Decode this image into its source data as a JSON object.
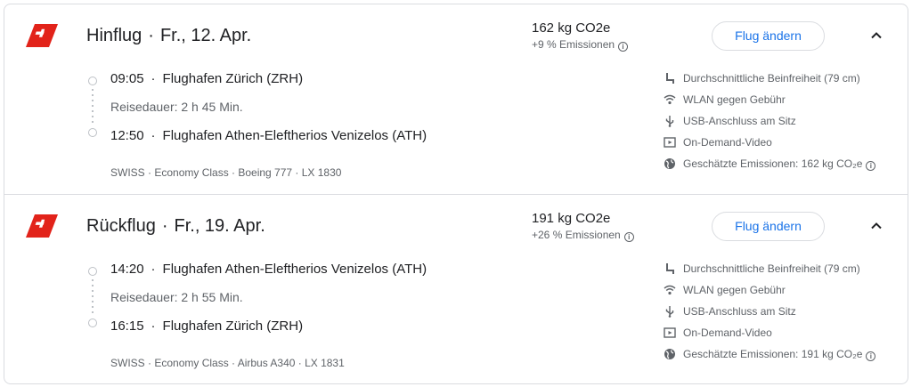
{
  "colors": {
    "accent": "#1a73e8",
    "swiss_red": "#e2231a",
    "muted": "#5f6368",
    "border": "#dadce0"
  },
  "segments": [
    {
      "title": "Hinflug",
      "title_sep": "·",
      "date": "Fr., 12. Apr.",
      "co2": "162 kg CO2e",
      "emissions": "+9 % Emissionen",
      "change_button": "Flug ändern",
      "departure": {
        "time": "09:05",
        "sep": "·",
        "airport": "Flughafen Zürich (ZRH)"
      },
      "duration": "Reisedauer: 2 h 45 Min.",
      "arrival": {
        "time": "12:50",
        "sep": "·",
        "airport": "Flughafen Athen-Eleftherios Venizelos (ATH)"
      },
      "meta": "SWISS · Economy Class · Boeing 777 · LX 1830",
      "amenities": [
        {
          "icon": "legroom-icon",
          "label": "Durchschnittliche Beinfreiheit (79 cm)"
        },
        {
          "icon": "wifi-icon",
          "label": "WLAN gegen Gebühr"
        },
        {
          "icon": "usb-icon",
          "label": "USB-Anschluss am Sitz"
        },
        {
          "icon": "video-icon",
          "label": "On-Demand-Video"
        },
        {
          "icon": "globe-icon",
          "label": "Geschätzte Emissionen: 162 kg CO₂e"
        }
      ]
    },
    {
      "title": "Rückflug",
      "title_sep": "·",
      "date": "Fr., 19. Apr.",
      "co2": "191 kg CO2e",
      "emissions": "+26 % Emissionen",
      "change_button": "Flug ändern",
      "departure": {
        "time": "14:20",
        "sep": "·",
        "airport": "Flughafen Athen-Eleftherios Venizelos (ATH)"
      },
      "duration": "Reisedauer: 2 h 55 Min.",
      "arrival": {
        "time": "16:15",
        "sep": "·",
        "airport": "Flughafen Zürich (ZRH)"
      },
      "meta": "SWISS · Economy Class · Airbus A340 · LX 1831",
      "amenities": [
        {
          "icon": "legroom-icon",
          "label": "Durchschnittliche Beinfreiheit (79 cm)"
        },
        {
          "icon": "wifi-icon",
          "label": "WLAN gegen Gebühr"
        },
        {
          "icon": "usb-icon",
          "label": "USB-Anschluss am Sitz"
        },
        {
          "icon": "video-icon",
          "label": "On-Demand-Video"
        },
        {
          "icon": "globe-icon",
          "label": "Geschätzte Emissionen: 191 kg CO₂e"
        }
      ]
    }
  ]
}
